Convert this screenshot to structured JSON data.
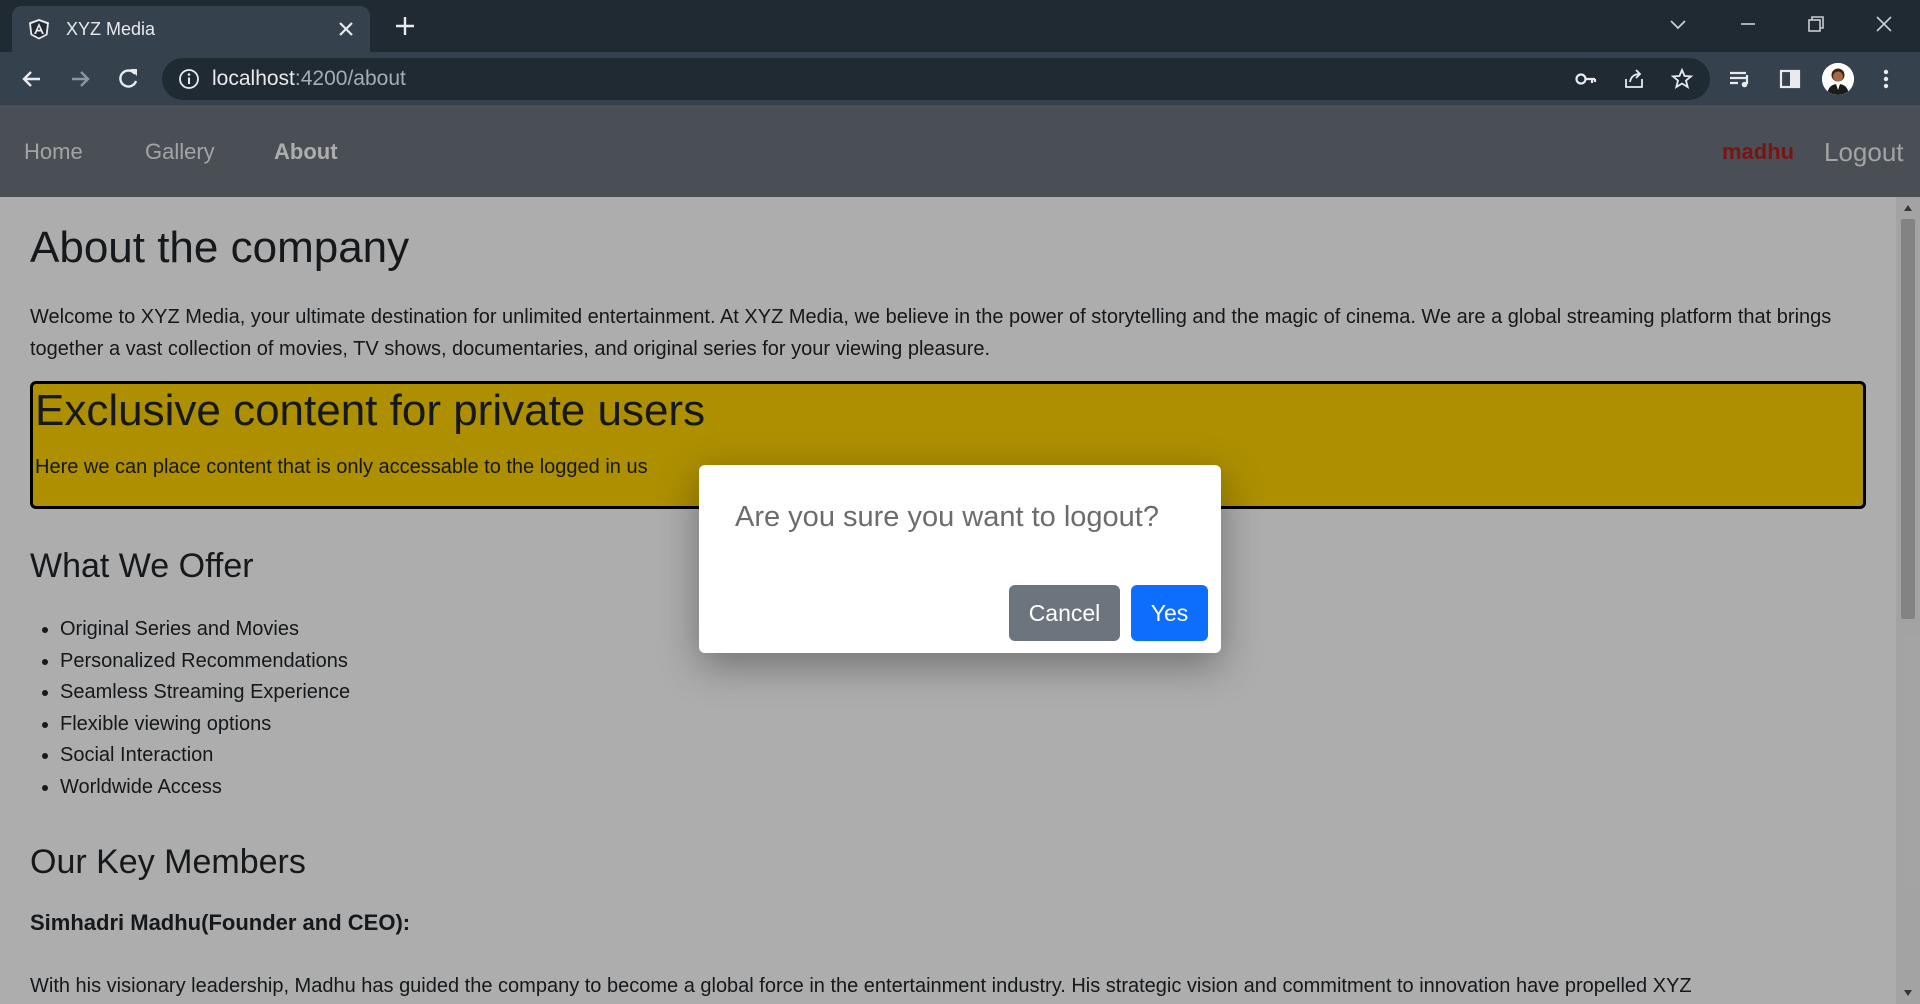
{
  "browser": {
    "tab_title": "XYZ Media",
    "url_host": "localhost",
    "url_rest": ":4200/about"
  },
  "navbar": {
    "links": [
      "Home",
      "Gallery",
      "About"
    ],
    "active_link": "About",
    "username": "madhu",
    "logout_label": "Logout"
  },
  "page": {
    "title": "About the company",
    "intro": "Welcome to XYZ Media, your ultimate destination for unlimited entertainment. At XYZ Media, we believe in the power of storytelling and the magic of cinema. We are a global streaming platform that brings together a vast collection of movies, TV shows, documentaries, and original series for your viewing pleasure.",
    "exclusive": {
      "heading": "Exclusive content for private users",
      "text": "Here we can place content that is only accessable to the logged in us"
    },
    "offer_heading": "What We Offer",
    "offers": [
      "Original Series and Movies",
      "Personalized Recommendations",
      "Seamless Streaming Experience",
      "Flexible viewing options",
      "Social Interaction",
      "Worldwide Access"
    ],
    "members_heading": "Our Key Members",
    "member_name": "Simhadri Madhu(Founder and CEO):",
    "member_text": "With his visionary leadership, Madhu has guided the company to become a global force in the entertainment industry. His strategic vision and commitment to innovation have propelled XYZ"
  },
  "dialog": {
    "message": "Are you sure you want to logout?",
    "cancel_label": "Cancel",
    "yes_label": "Yes"
  },
  "colors": {
    "navbar": "#6c757d",
    "exclusive_bg": "#ffd300",
    "username": "#b41e1e",
    "yes_button": "#0d6efd",
    "cancel_button": "#6c757d"
  }
}
